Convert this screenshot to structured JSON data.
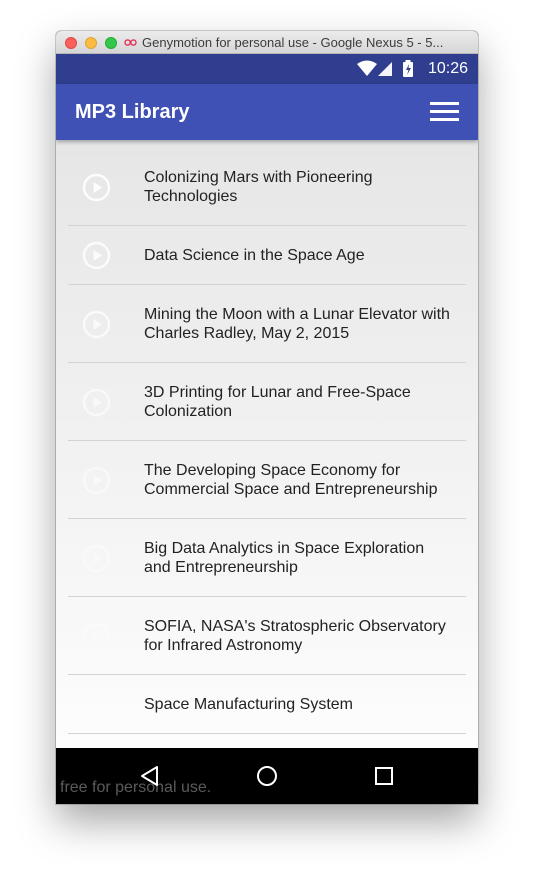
{
  "window": {
    "title": "Genymotion for personal use - Google Nexus 5 - 5..."
  },
  "status_bar": {
    "time": "10:26",
    "icons": [
      "wifi-icon",
      "signal-icon",
      "battery-charging-icon"
    ]
  },
  "app_bar": {
    "title": "MP3 Library",
    "menu_icon": "hamburger-menu-icon"
  },
  "tracks": [
    {
      "title": "Colonizing Mars with Pioneering Technologies",
      "icon": "play-circle-icon"
    },
    {
      "title": "Data Science in the Space Age",
      "icon": "play-circle-icon"
    },
    {
      "title": "Mining the Moon with a Lunar Elevator with Charles Radley, May 2, 2015",
      "icon": "play-circle-icon"
    },
    {
      "title": "3D Printing for Lunar and Free-Space Colonization",
      "icon": "play-circle-icon"
    },
    {
      "title": "The Developing Space Economy for Commercial Space and Entrepreneurship",
      "icon": "play-circle-icon"
    },
    {
      "title": "Big Data Analytics in Space Exploration and Entrepreneurship",
      "icon": "play-circle-icon"
    },
    {
      "title": "SOFIA, NASA's Stratospheric Observatory for Infrared Astronomy",
      "icon": "play-circle-icon"
    },
    {
      "title": "Space Manufacturing System",
      "icon": "play-circle-icon"
    }
  ],
  "nav_bar": {
    "icons": [
      "back-icon",
      "home-icon",
      "recents-icon"
    ]
  },
  "watermark": "free for personal use.",
  "colors": {
    "status_bar": "#2f3e8f",
    "app_bar": "#3f51b5",
    "nav_bar": "#000000"
  }
}
